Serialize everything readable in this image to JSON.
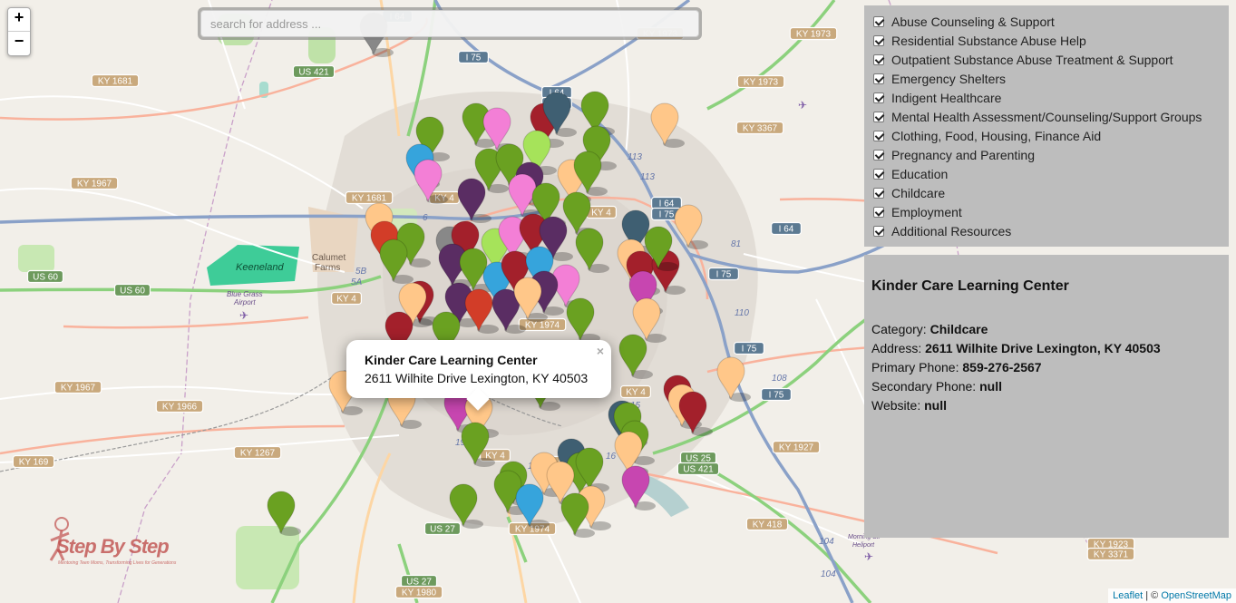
{
  "map": {
    "zoom_in": "+",
    "zoom_out": "−",
    "search_placeholder": "search for address ...",
    "place_labels": [
      {
        "name": "Keeneland"
      },
      {
        "name": "Calumet"
      },
      {
        "name": "Farms"
      },
      {
        "name": "Blue Grass"
      },
      {
        "name": "Airport"
      },
      {
        "name": "Morning St."
      },
      {
        "name": "Heliport"
      }
    ],
    "shields": [
      "I 64",
      "KY 1973",
      "KY 1973",
      "I 75",
      "US 421",
      "KY 1681",
      "I 64",
      "I 75",
      "KY 1973",
      "KY 3367",
      "KY 1967",
      "KY 1681",
      "I 64",
      "I 75",
      "I 64",
      "US 60",
      "US 60",
      "I 75",
      "KY 4",
      "KY 4",
      "KY 4",
      "KY 1974",
      "I 75",
      "KY 1967",
      "KY 1966",
      "I 75",
      "KY 4",
      "KY 1267",
      "KY 169",
      "KY 4",
      "US 25",
      "US 421",
      "KY 1927",
      "US 27",
      "KY 1974",
      "KY 418",
      "US 27",
      "KY 1980",
      "KY 1923",
      "KY 3371",
      "KY 4"
    ],
    "route_numbers": [
      "113",
      "113",
      "81",
      "110",
      "108",
      "15",
      "16",
      "18",
      "19",
      "5B",
      "5A",
      "6",
      "104",
      "104"
    ]
  },
  "markers_colors": {
    "olive": "#6aa121",
    "light_green": "#a6e35a",
    "pink": "#f37fd6",
    "magenta": "#c746b0",
    "dark_purple": "#5a2d63",
    "red": "#d23d28",
    "dark_red": "#a3202b",
    "orange_tan": "#ffc789",
    "sky_blue": "#36a4dc",
    "slate": "#3f5f72",
    "gray": "#888888"
  },
  "popup": {
    "title": "Kinder Care Learning Center",
    "address": "2611 Wilhite Drive Lexington, KY 40503",
    "close": "×"
  },
  "categories": [
    {
      "label": "Abuse Counseling & Support",
      "checked": true
    },
    {
      "label": "Residential Substance Abuse Help",
      "checked": true
    },
    {
      "label": "Outpatient Substance Abuse Treatment & Support",
      "checked": true
    },
    {
      "label": "Emergency Shelters",
      "checked": true
    },
    {
      "label": "Indigent Healthcare",
      "checked": true
    },
    {
      "label": "Mental Health Assessment/Counseling/Support Groups",
      "checked": true
    },
    {
      "label": "Clothing, Food, Housing, Finance Aid",
      "checked": true
    },
    {
      "label": "Pregnancy and Parenting",
      "checked": true
    },
    {
      "label": "Education",
      "checked": true
    },
    {
      "label": "Childcare",
      "checked": true
    },
    {
      "label": "Employment",
      "checked": true
    },
    {
      "label": "Additional Resources",
      "checked": true
    }
  ],
  "info": {
    "title": "Kinder Care Learning Center",
    "category_label": "Category:",
    "category_value": "Childcare",
    "address_label": "Address:",
    "address_value": "2611 Wilhite Drive Lexington, KY 40503",
    "primary_phone_label": "Primary Phone:",
    "primary_phone_value": "859-276-2567",
    "secondary_phone_label": "Secondary Phone:",
    "secondary_phone_value": "null",
    "website_label": "Website:",
    "website_value": "null"
  },
  "attribution": {
    "leaflet": "Leaflet",
    "separator": " | © ",
    "osm": "OpenStreetMap"
  },
  "logo": {
    "text": "Step By Step",
    "tagline": "Mentoring Teen Moms, Transforming Lives for Generations"
  }
}
